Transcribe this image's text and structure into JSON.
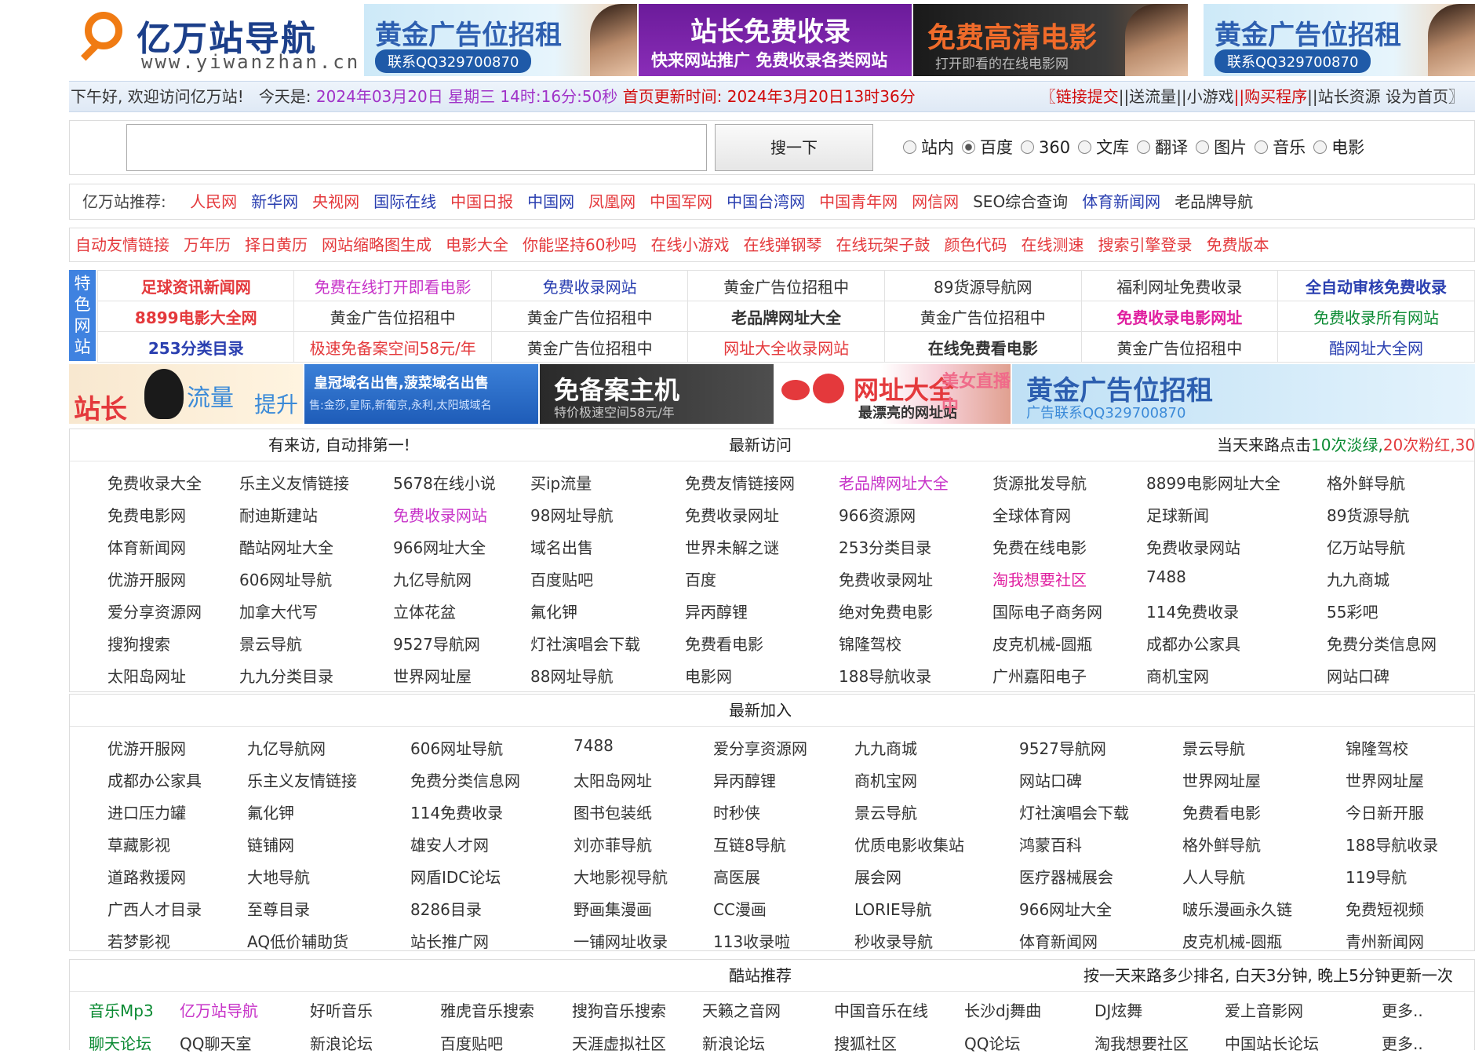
{
  "logo": {
    "title": "亿万站导航",
    "url": "www.yiwanzhan.cn"
  },
  "banners": {
    "b1": {
      "title": "黄金广告位招租",
      "contact": "联系QQ329700870"
    },
    "b2": {
      "title": "站长免费收录",
      "sub": "快来网站推广 免费收录各类网站"
    },
    "b3": {
      "title": "免费高清电影",
      "sub": "打开即看的在线电影网"
    },
    "b4": {
      "title": "黄金广告位招租",
      "contact": "联系QQ329700870"
    }
  },
  "info": {
    "greeting": "下午好, 欢迎访问亿万站!",
    "today_label": "今天是:",
    "date": "2024年03月20日 星期三 14时:16分:50秒",
    "update_label": "首页更新时间:",
    "update_time": "2024年3月20日13时36分",
    "right": {
      "submit": "〖链接提交",
      "traffic": "||送流量",
      "game": "||小游戏",
      "buy": "||购买程序",
      "res": "||站长资源",
      "home": "设为首页〗"
    }
  },
  "search": {
    "placeholder": "",
    "button": "搜一下",
    "options": [
      {
        "label": "站内",
        "checked": false
      },
      {
        "label": "百度",
        "checked": true
      },
      {
        "label": "360",
        "checked": false
      },
      {
        "label": "文库",
        "checked": false
      },
      {
        "label": "翻译",
        "checked": false
      },
      {
        "label": "图片",
        "checked": false
      },
      {
        "label": "音乐",
        "checked": false
      },
      {
        "label": "电影",
        "checked": false
      }
    ]
  },
  "recommend": {
    "label": "亿万站推荐:",
    "items": [
      {
        "text": "人民网",
        "color": "#e4393c"
      },
      {
        "text": "新华网",
        "color": "#2a3fb0"
      },
      {
        "text": "央视网",
        "color": "#e4393c"
      },
      {
        "text": "国际在线",
        "color": "#2a3fb0"
      },
      {
        "text": "中国日报",
        "color": "#e4393c"
      },
      {
        "text": "中国网",
        "color": "#2a3fb0"
      },
      {
        "text": "凤凰网",
        "color": "#e4393c"
      },
      {
        "text": "中国军网",
        "color": "#e4393c"
      },
      {
        "text": "中国台湾网",
        "color": "#2a3fb0"
      },
      {
        "text": "中国青年网",
        "color": "#e4393c"
      },
      {
        "text": "网信网",
        "color": "#e4393c"
      },
      {
        "text": "SEO综合查询",
        "color": "#333333"
      },
      {
        "text": "体育新闻网",
        "color": "#2a3fb0"
      },
      {
        "text": "老品牌导航",
        "color": "#333333"
      }
    ]
  },
  "tools": [
    "自动友情链接",
    "万年历",
    "择日黄历",
    "网站缩略图生成",
    "电影大全",
    "你能坚持60秒吗",
    "在线小游戏",
    "在线弹钢琴",
    "在线玩架子鼓",
    "颜色代码",
    "在线测速",
    "搜索引擎登录",
    "免费版本"
  ],
  "featured": {
    "side": "特色网站",
    "rows": [
      [
        {
          "t": "足球资讯新闻网",
          "c": "#e4393c",
          "b": true
        },
        {
          "t": "免费在线打开即看电影",
          "c": "#c733c8",
          "b": false
        },
        {
          "t": "免费收录网站",
          "c": "#2a3fb0",
          "b": false
        },
        {
          "t": "黄金广告位招租中",
          "c": "#333333",
          "b": false
        },
        {
          "t": "89货源导航网",
          "c": "#333333",
          "b": false
        },
        {
          "t": "福利网址免费收录",
          "c": "#333333",
          "b": false
        },
        {
          "t": "全自动审核免费收录",
          "c": "#2a3fb0",
          "b": true
        }
      ],
      [
        {
          "t": "8899电影大全网",
          "c": "#e4393c",
          "b": true
        },
        {
          "t": "黄金广告位招租中",
          "c": "#333333",
          "b": false
        },
        {
          "t": "黄金广告位招租中",
          "c": "#333333",
          "b": false
        },
        {
          "t": "老品牌网址大全",
          "c": "#333333",
          "b": true
        },
        {
          "t": "黄金广告位招租中",
          "c": "#333333",
          "b": false
        },
        {
          "t": "免费收录电影网址",
          "c": "#e020a0",
          "b": true
        },
        {
          "t": "免费收录所有网站",
          "c": "#0a8a32",
          "b": false
        }
      ],
      [
        {
          "t": "253分类目录",
          "c": "#2a3fb0",
          "b": true
        },
        {
          "t": "极速免备案空间58元/年",
          "c": "#e4393c",
          "b": false
        },
        {
          "t": "黄金广告位招租中",
          "c": "#333333",
          "b": false
        },
        {
          "t": "网址大全收录网站",
          "c": "#e4393c",
          "b": false
        },
        {
          "t": "在线免费看电影",
          "c": "#333333",
          "b": true
        },
        {
          "t": "黄金广告位招租中",
          "c": "#333333",
          "b": false
        },
        {
          "t": "酷网址大全网",
          "c": "#2a3fb0",
          "b": false
        }
      ]
    ]
  },
  "ads": {
    "a1": {
      "t1": "站长",
      "t2": "流量",
      "t3": "提升"
    },
    "a2": {
      "t1": "皇冠域名出售,菠菜域名出售",
      "t2": "售:金莎,皇际,新葡京,永利,太阳城域名"
    },
    "a3": {
      "t1": "免备案主机",
      "t2": "特价极速空间58元/年"
    },
    "a4": {
      "t1": "网址大全",
      "t2": "最漂亮的网址站",
      "t3": "美女直播中"
    },
    "a5": {
      "t1": "黄金广告位招租",
      "t2": "广告联系QQ329700870"
    }
  },
  "recent": {
    "left": "有来访, 自动排第一!",
    "title": "最新访问",
    "right_a": "当天来路点击",
    "right_b": "10次淡绿,",
    "right_c": "20次粉红,",
    "right_d": "30",
    "rows": [
      [
        "免费收录大全",
        "乐主义友情链接",
        "5678在线小说",
        "买ip流量",
        "免费友情链接网",
        "老品牌网址大全",
        "货源批发导航",
        "8899电影网址大全",
        "格外鲜导航"
      ],
      [
        "免费电影网",
        "耐迪斯建站",
        "免费收录网站",
        "98网址导航",
        "免费收录网址",
        "966资源网",
        "全球体育网",
        "足球新闻",
        "89货源导航"
      ],
      [
        "体育新闻网",
        "酷站网址大全",
        "966网址大全",
        "域名出售",
        "世界未解之谜",
        "253分类目录",
        "免费在线电影",
        "免费收录网站",
        "亿万站导航"
      ],
      [
        "优游开服网",
        "606网址导航",
        "九亿导航网",
        "百度贴吧",
        "百度",
        "免费收录网址",
        "淘我想要社区",
        "7488",
        "九九商城"
      ],
      [
        "爱分享资源网",
        "加拿大代写",
        "立体花盆",
        "氟化钾",
        "异丙醇锂",
        "绝对免费电影",
        "国际电子商务网",
        "114免费收录",
        "55彩吧"
      ],
      [
        "搜狗搜索",
        "景云导航",
        "9527导航网",
        "灯社演唱会下载",
        "免费看电影",
        "锦隆驾校",
        "皮克机械-圆瓶",
        "成都办公家具",
        "免费分类信息网"
      ],
      [
        "太阳岛网址",
        "九九分类目录",
        "世界网址屋",
        "88网址导航",
        "电影网",
        "188导航收录",
        "广州嘉阳电子",
        "商机宝网",
        "网站口碑"
      ]
    ]
  },
  "newest": {
    "title": "最新加入",
    "rows": [
      [
        "优游开服网",
        "九亿导航网",
        "606网址导航",
        "7488",
        "爱分享资源网",
        "九九商城",
        "9527导航网",
        "景云导航",
        "锦隆驾校"
      ],
      [
        "成都办公家具",
        "乐主义友情链接",
        "免费分类信息网",
        "太阳岛网址",
        "异丙醇锂",
        "商机宝网",
        "网站口碑",
        "世界网址屋",
        "世界网址屋"
      ],
      [
        "进口压力罐",
        "氟化钾",
        "114免费收录",
        "图书包装纸",
        "时秒侠",
        "景云导航",
        "灯社演唱会下载",
        "免费看电影",
        "今日新开服"
      ],
      [
        "草藏影视",
        "链铺网",
        "雄安人才网",
        "刘亦菲导航",
        "互链8导航",
        "优质电影收集站",
        "鸿蒙百科",
        "格外鲜导航",
        "188导航收录"
      ],
      [
        "道路救援网",
        "大地导航",
        "网盾IDC论坛",
        "大地影视导航",
        "高医展",
        "展会网",
        "医疗器械展会",
        "人人导航",
        "119导航"
      ],
      [
        "广西人才目录",
        "至尊目录",
        "8286目录",
        "野画集漫画",
        "CC漫画",
        "LORIE导航",
        "966网址大全",
        "啵乐漫画永久链",
        "免费短视频"
      ],
      [
        "若梦影视",
        "AQ低价辅助货",
        "站长推广网",
        "一铺网址收录",
        "113收录啦",
        "秒收录导航",
        "体育新闻网",
        "皮克机械-圆瓶",
        "青州新闻网"
      ]
    ]
  },
  "cool": {
    "title": "酷站推荐",
    "right": "按一天来路多少排名, 白天3分钟, 晚上5分钟更新一次",
    "rows": [
      [
        {
          "t": "音乐Mp3",
          "c": "#0a8a32"
        },
        {
          "t": "亿万站导航",
          "c": "#c733c8"
        },
        {
          "t": "好听音乐",
          "c": "#333333"
        },
        {
          "t": "雅虎音乐搜索",
          "c": "#333333"
        },
        {
          "t": "搜狗音乐搜索",
          "c": "#333333"
        },
        {
          "t": "天籁之音网",
          "c": "#333333"
        },
        {
          "t": "中国音乐在线",
          "c": "#333333"
        },
        {
          "t": "长沙dj舞曲",
          "c": "#333333"
        },
        {
          "t": "DJ炫舞",
          "c": "#333333"
        },
        {
          "t": "爱上音影网",
          "c": "#333333"
        },
        {
          "t": "更多..",
          "c": "#333333"
        }
      ],
      [
        {
          "t": "聊天论坛",
          "c": "#0a8a32"
        },
        {
          "t": "QQ聊天室",
          "c": "#333333"
        },
        {
          "t": "新浪论坛",
          "c": "#333333"
        },
        {
          "t": "百度贴吧",
          "c": "#333333"
        },
        {
          "t": "天涯虚拟社区",
          "c": "#333333"
        },
        {
          "t": "新浪论坛",
          "c": "#333333"
        },
        {
          "t": "搜狐社区",
          "c": "#333333"
        },
        {
          "t": "QQ论坛",
          "c": "#333333"
        },
        {
          "t": "淘我想要社区",
          "c": "#333333"
        },
        {
          "t": "中国站长论坛",
          "c": "#333333"
        },
        {
          "t": "更多..",
          "c": "#333333"
        }
      ]
    ]
  }
}
